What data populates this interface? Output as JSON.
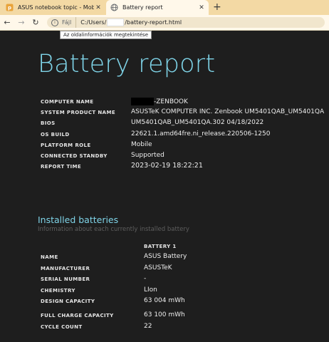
{
  "tabs": [
    {
      "title": "ASUS notebook topic - Mobilarena",
      "icon": "asus-favicon-icon"
    },
    {
      "title": "Battery report",
      "icon": "globe-icon"
    }
  ],
  "address": {
    "chip": "Fájl",
    "url_prefix": "C:/Users/",
    "url_suffix": "/battery-report.html",
    "tooltip": "Az oldalinformációk megtekintése"
  },
  "page": {
    "title": "Battery report",
    "system_info": [
      {
        "label": "COMPUTER NAME",
        "value": "-ZENBOOK"
      },
      {
        "label": "SYSTEM PRODUCT NAME",
        "value": "ASUSTeK COMPUTER INC. Zenbook UM5401QAB_UM5401QA"
      },
      {
        "label": "BIOS",
        "value": "UM5401QAB_UM5401QA.302 04/18/2022"
      },
      {
        "label": "OS BUILD",
        "value": "22621.1.amd64fre.ni_release.220506-1250"
      },
      {
        "label": "PLATFORM ROLE",
        "value": "Mobile"
      },
      {
        "label": "CONNECTED STANDBY",
        "value": "Supported"
      },
      {
        "label": "REPORT TIME",
        "value": "2023-02-19   18:22:21"
      }
    ],
    "installed": {
      "title": "Installed batteries",
      "subtitle": "Information about each currently installed battery",
      "column": "BATTERY 1",
      "rows": [
        {
          "label": "NAME",
          "value": "ASUS Battery"
        },
        {
          "label": "MANUFACTURER",
          "value": "ASUSTeK"
        },
        {
          "label": "SERIAL NUMBER",
          "value": "-"
        },
        {
          "label": "CHEMISTRY",
          "value": "LIon"
        },
        {
          "label": "DESIGN CAPACITY",
          "value": "63 004 mWh"
        },
        {
          "label": "FULL CHARGE CAPACITY",
          "value": "63 100 mWh"
        },
        {
          "label": "CYCLE COUNT",
          "value": "22"
        }
      ]
    }
  },
  "colors": {
    "accent": "#7fd4e8",
    "tabbar": "#f3d9a4",
    "background": "#1e1e1e"
  }
}
